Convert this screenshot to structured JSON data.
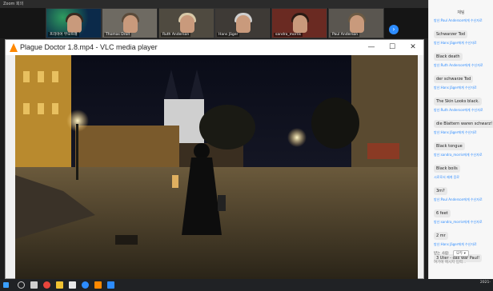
{
  "zoom": {
    "title": "Zoom 회의",
    "next_label": "›",
    "participants": [
      {
        "name": "프리미어 부모프래",
        "bg": "#0b2a4a"
      },
      {
        "name": "Thomas Droit",
        "bg": "#6e6a62"
      },
      {
        "name": "Ruth Anderson",
        "bg": "#5b5547"
      },
      {
        "name": "Hans Jäger",
        "bg": "#3e3a36"
      },
      {
        "name": "sandra_morris",
        "bg": "#6a2a22"
      },
      {
        "name": "Paul Anderson",
        "bg": "#5a5650"
      }
    ]
  },
  "vlc": {
    "title": "Plague Doctor 1.8.mp4 - VLC media player",
    "minimize_label": "—",
    "maximize_label": "☐",
    "close_label": "✕"
  },
  "chat": {
    "header": "채팅",
    "messages": [
      {
        "meta": "방신:Paul Anderson에게 수신자로",
        "text": "Schwarzer Tod"
      },
      {
        "meta": "방신:Hans Jäger에게 수신자로",
        "text": "Black death"
      },
      {
        "meta": "방신:Ruth Anderson에게 수신자로",
        "text": "der schwarze Tod"
      },
      {
        "meta": "방신:Hans Jäger에게 수신자로",
        "text": "The Skin Looks black."
      },
      {
        "meta": "방신:Ruth Anderson에게 수신자로",
        "text": "die Blattern waren schwarz!"
      },
      {
        "meta": "방신:Hans Jäger에게 수신자로",
        "text": "Black tongue"
      },
      {
        "meta": "방신:sandra_morris에게 수신자로",
        "text": "Black boils"
      },
      {
        "meta": "시로로서 제게 응로",
        "text": "3m?"
      },
      {
        "meta": "방신:Paul Anderson에게 수신자로",
        "text": "6 feet"
      },
      {
        "meta": "방신:sandra_morris에게 수신자로",
        "text": "2 mr"
      },
      {
        "meta": "방신:Hans Jäger에게 수신자로",
        "text": "3 Uter - das war Paul!"
      }
    ],
    "to_label": "받는 사람:",
    "to_value": "모두",
    "input_placeholder": "여기에 메시지 입력..."
  },
  "taskbar": {
    "time": "",
    "date": "2021-"
  }
}
